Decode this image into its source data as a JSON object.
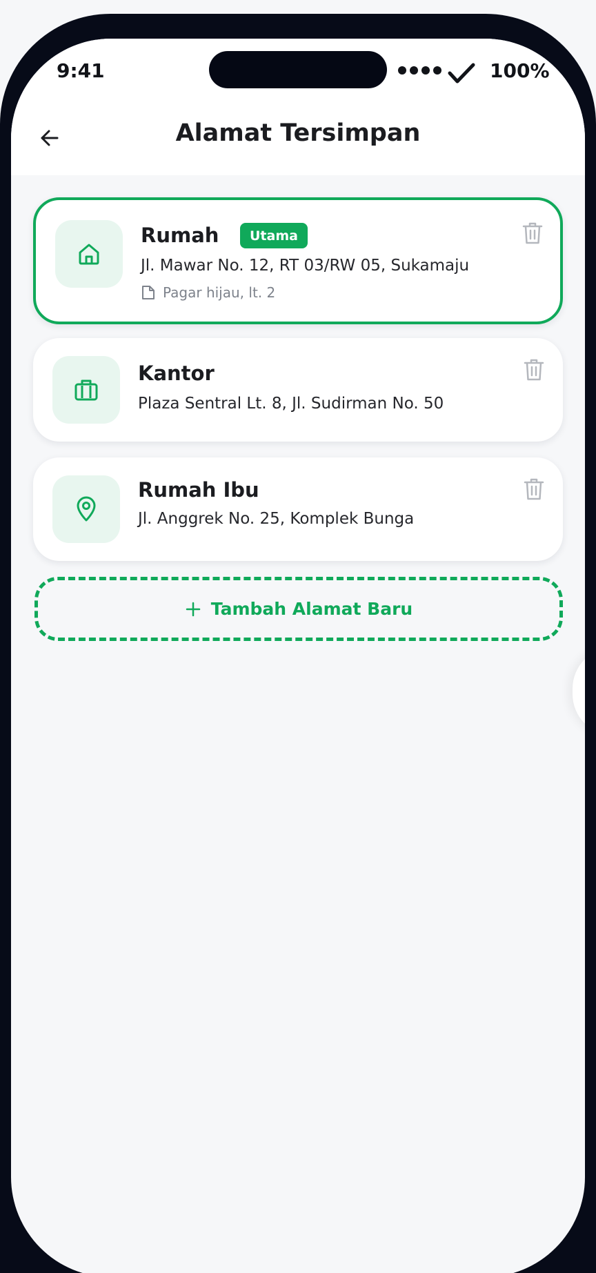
{
  "status_bar": {
    "time": "9:41",
    "battery": "100%"
  },
  "header": {
    "title": "Alamat Tersimpan"
  },
  "addresses": [
    {
      "name": "Rumah",
      "badge": "Utama",
      "address": "Jl. Mawar No. 12, RT 03/RW 05, Sukamaju",
      "note": "Pagar hijau, lt. 2",
      "icon": "home-icon",
      "selected": true
    },
    {
      "name": "Kantor",
      "address": "Plaza Sentral Lt. 8, Jl. Sudirman No. 50",
      "icon": "briefcase-icon",
      "selected": false
    },
    {
      "name": "Rumah Ibu",
      "address": "Jl. Anggrek No. 25, Komplek Bunga",
      "icon": "map-pin-icon",
      "selected": false
    }
  ],
  "add_button": {
    "label": "Tambah Alamat Baru"
  },
  "colors": {
    "accent": "#10a95a",
    "icon_bg": "#e8f6ef",
    "background": "#f6f7f9",
    "frame": "#070b18"
  }
}
